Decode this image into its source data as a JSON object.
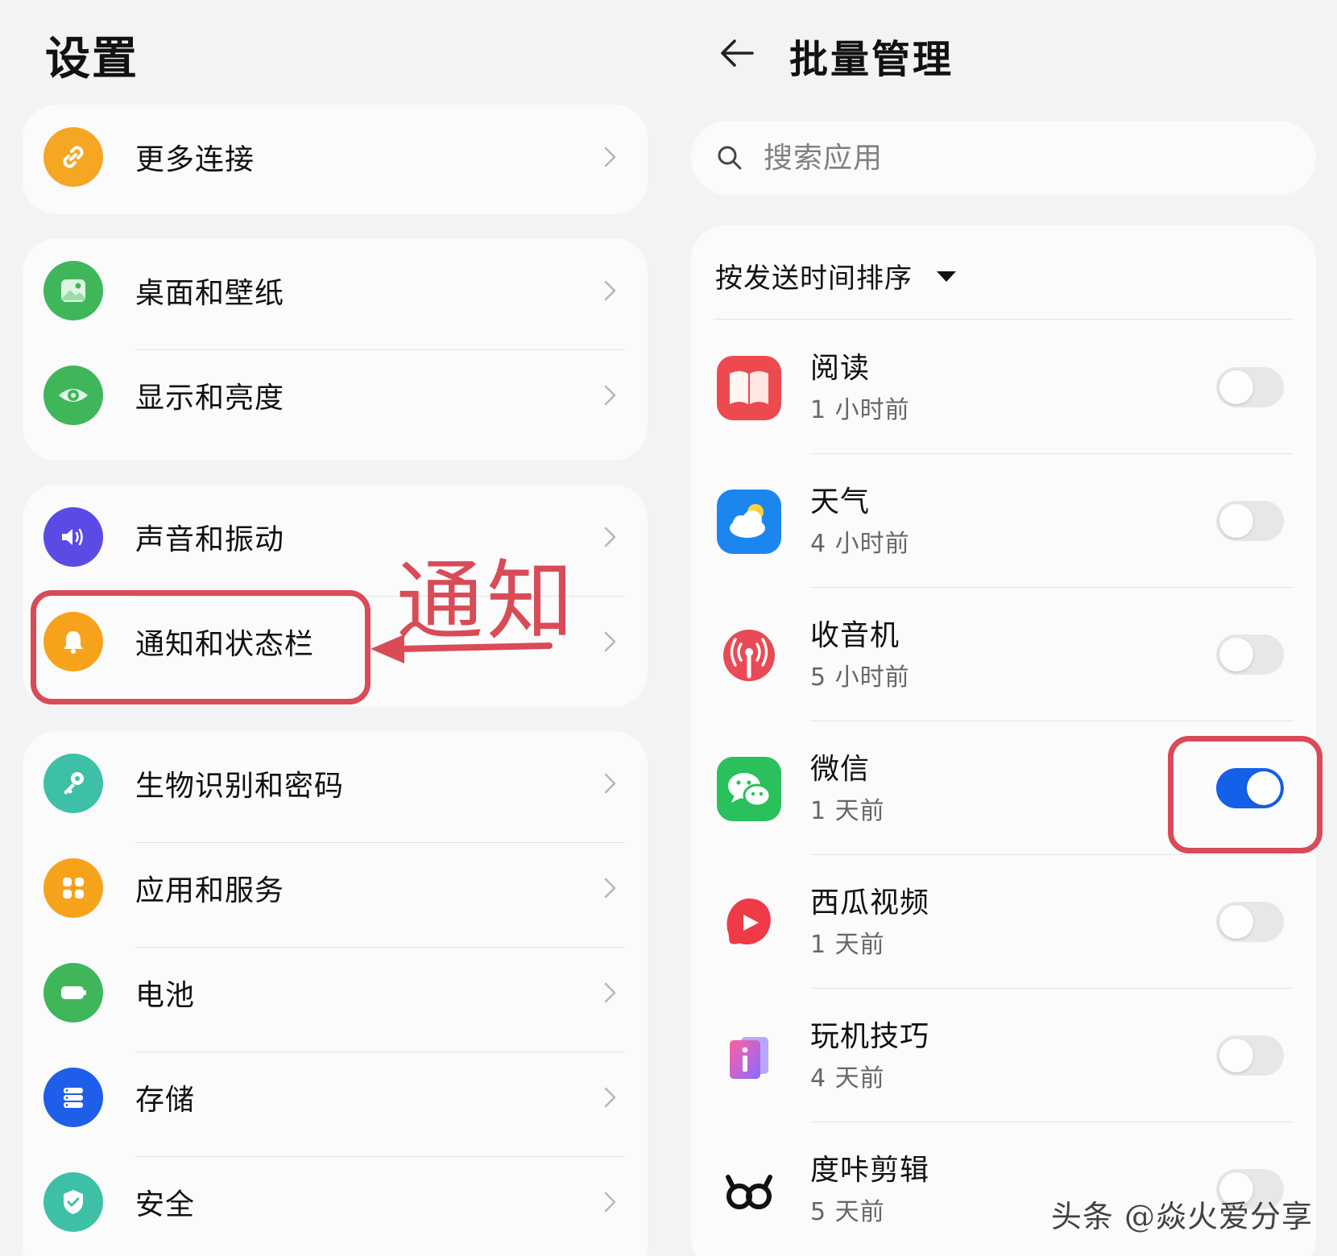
{
  "left": {
    "title": "设置",
    "groups": [
      [
        {
          "label": "更多连接",
          "icon": "link-icon",
          "color": "#f5a623"
        }
      ],
      [
        {
          "label": "桌面和壁纸",
          "icon": "image-icon",
          "color": "#3fb65a"
        },
        {
          "label": "显示和亮度",
          "icon": "eye-icon",
          "color": "#3fb65a"
        }
      ],
      [
        {
          "label": "声音和振动",
          "icon": "speaker-icon",
          "color": "#5b4be5"
        },
        {
          "label": "通知和状态栏",
          "icon": "bell-icon",
          "color": "#f7a21b"
        }
      ],
      [
        {
          "label": "生物识别和密码",
          "icon": "key-icon",
          "color": "#3ec0a6"
        },
        {
          "label": "应用和服务",
          "icon": "apps-icon",
          "color": "#f7a21b"
        },
        {
          "label": "电池",
          "icon": "battery-icon",
          "color": "#3fb65a"
        },
        {
          "label": "存储",
          "icon": "storage-icon",
          "color": "#1e5ee8"
        },
        {
          "label": "安全",
          "icon": "shield-icon",
          "color": "#3ec0a6"
        }
      ]
    ],
    "annotation": "通知"
  },
  "right": {
    "title": "批量管理",
    "search_placeholder": "搜索应用",
    "sort_label": "按发送时间排序",
    "apps": [
      {
        "name": "阅读",
        "time": "1 小时前",
        "on": false,
        "icon": "book-icon"
      },
      {
        "name": "天气",
        "time": "4 小时前",
        "on": false,
        "icon": "weather-icon"
      },
      {
        "name": "收音机",
        "time": "5 小时前",
        "on": false,
        "icon": "radio-icon"
      },
      {
        "name": "微信",
        "time": "1 天前",
        "on": true,
        "icon": "wechat-icon"
      },
      {
        "name": "西瓜视频",
        "time": "1 天前",
        "on": false,
        "icon": "xigua-video-icon"
      },
      {
        "name": "玩机技巧",
        "time": "4 天前",
        "on": false,
        "icon": "tips-icon"
      },
      {
        "name": "度咔剪辑",
        "time": "5 天前",
        "on": false,
        "icon": "dukajianji-icon"
      }
    ]
  },
  "watermark": "头条 @焱火爱分享",
  "colors": {
    "accent": "#1560e9",
    "annotation": "#d94b57"
  }
}
